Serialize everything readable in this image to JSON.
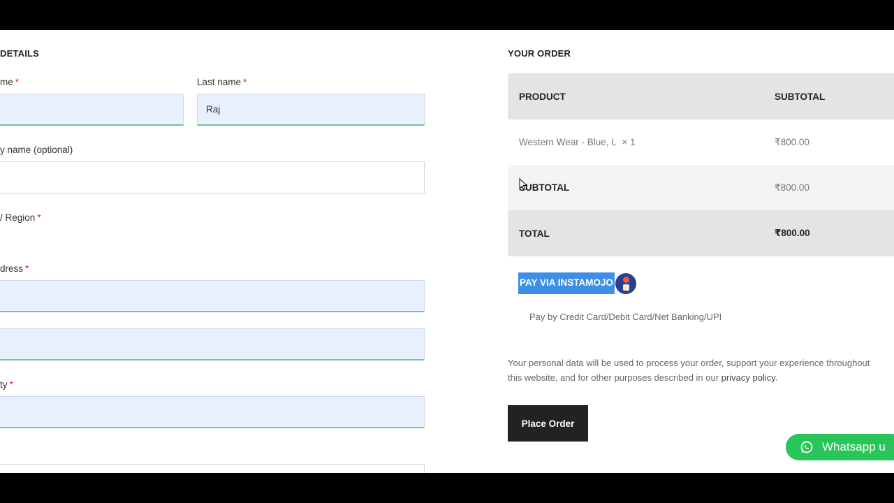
{
  "billing": {
    "heading": "DETAILS",
    "first_name": {
      "label": "me",
      "required": "*",
      "value": ""
    },
    "last_name": {
      "label": "Last name",
      "required": "*",
      "value": "Raj"
    },
    "company": {
      "label": "y name (optional)",
      "value": ""
    },
    "country": {
      "label": "/ Region",
      "required": "*"
    },
    "address": {
      "label": "dress",
      "required": "*",
      "line1": "",
      "line2": ""
    },
    "city": {
      "label": "ty",
      "required": "*",
      "value": ""
    }
  },
  "order": {
    "heading": "YOUR ORDER",
    "columns": {
      "product": "PRODUCT",
      "subtotal": "SUBTOTAL"
    },
    "items": [
      {
        "name": "Western Wear - Blue, L",
        "qty": "× 1",
        "price": "₹800.00"
      }
    ],
    "subtotal": {
      "label": "SUBTOTAL",
      "value": "₹800.00"
    },
    "total": {
      "label": "TOTAL",
      "value": "₹800.00"
    }
  },
  "payment": {
    "method_label": "PAY VIA INSTAMOJO",
    "description": "Pay by Credit Card/Debit Card/Net Banking/UPI"
  },
  "privacy": {
    "text": "Your personal data will be used to process your order, support your experience throughout this website, and for other purposes described in our ",
    "link": "privacy policy",
    "end": "."
  },
  "place_order_label": "Place Order",
  "whatsapp_label": "Whatsapp u",
  "colors": {
    "accent_green": "#28c55a",
    "pay_highlight": "#3d8fe6",
    "required": "#d9242a"
  }
}
